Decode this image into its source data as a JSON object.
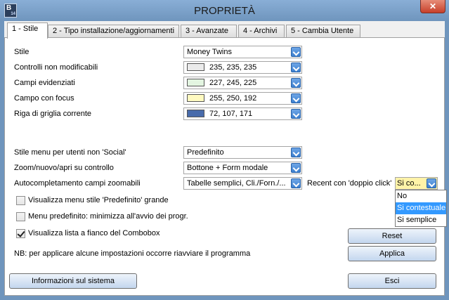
{
  "window": {
    "title": "PROPRIETÀ",
    "icon_letter": "B",
    "icon_sub": "14",
    "close_glyph": "✕"
  },
  "tabs": [
    {
      "label": "1 - Stile",
      "active": true
    },
    {
      "label": "2 - Tipo installazione/aggiornamenti",
      "active": false
    },
    {
      "label": "3 - Avanzate",
      "active": false
    },
    {
      "label": "4 - Archivi",
      "active": false
    },
    {
      "label": "5 - Cambia Utente",
      "active": false
    }
  ],
  "fields": {
    "stile": {
      "label": "Stile",
      "value": "Money Twins"
    },
    "controlli": {
      "label": "Controlli non modificabili",
      "value": "235, 235, 235",
      "color": "#ebebeb"
    },
    "evidenziati": {
      "label": "Campi evidenziati",
      "value": "227, 245, 225",
      "color": "#e3f5e1"
    },
    "focus": {
      "label": "Campo con focus",
      "value": "255, 250, 192",
      "color": "#fffac0"
    },
    "griglia": {
      "label": "Riga di griglia corrente",
      "value": "72, 107, 171",
      "color": "#486bab"
    },
    "menu_social": {
      "label": "Stile menu per utenti non 'Social'",
      "value": "Predefinito"
    },
    "zoom": {
      "label": "Zoom/nuovo/apri su controllo",
      "value": "Bottone + Form modale"
    },
    "autocomp": {
      "label": "Autocompletamento campi zoomabili",
      "value": "Tabelle semplici, Cli./Forn./..."
    },
    "recent": {
      "label": "Recent con 'doppio click'",
      "value": "Si co..."
    }
  },
  "recent_dropdown": {
    "options": [
      "No",
      "Si contestuale",
      "Si semplice"
    ],
    "selected_index": 1
  },
  "checkboxes": [
    {
      "label": "Visualizza menu stile 'Predefinito' grande",
      "checked": false
    },
    {
      "label": "Menu predefinito: minimizza all'avvio dei progr.",
      "checked": false
    },
    {
      "label": "Visualizza lista a fianco del Combobox",
      "checked": true
    }
  ],
  "note": "NB: per applicare alcune impostazioni occorre riavviare il programma",
  "buttons": {
    "reset": "Reset",
    "applica": "Applica",
    "info": "Informazioni sul sistema",
    "esci": "Esci"
  }
}
